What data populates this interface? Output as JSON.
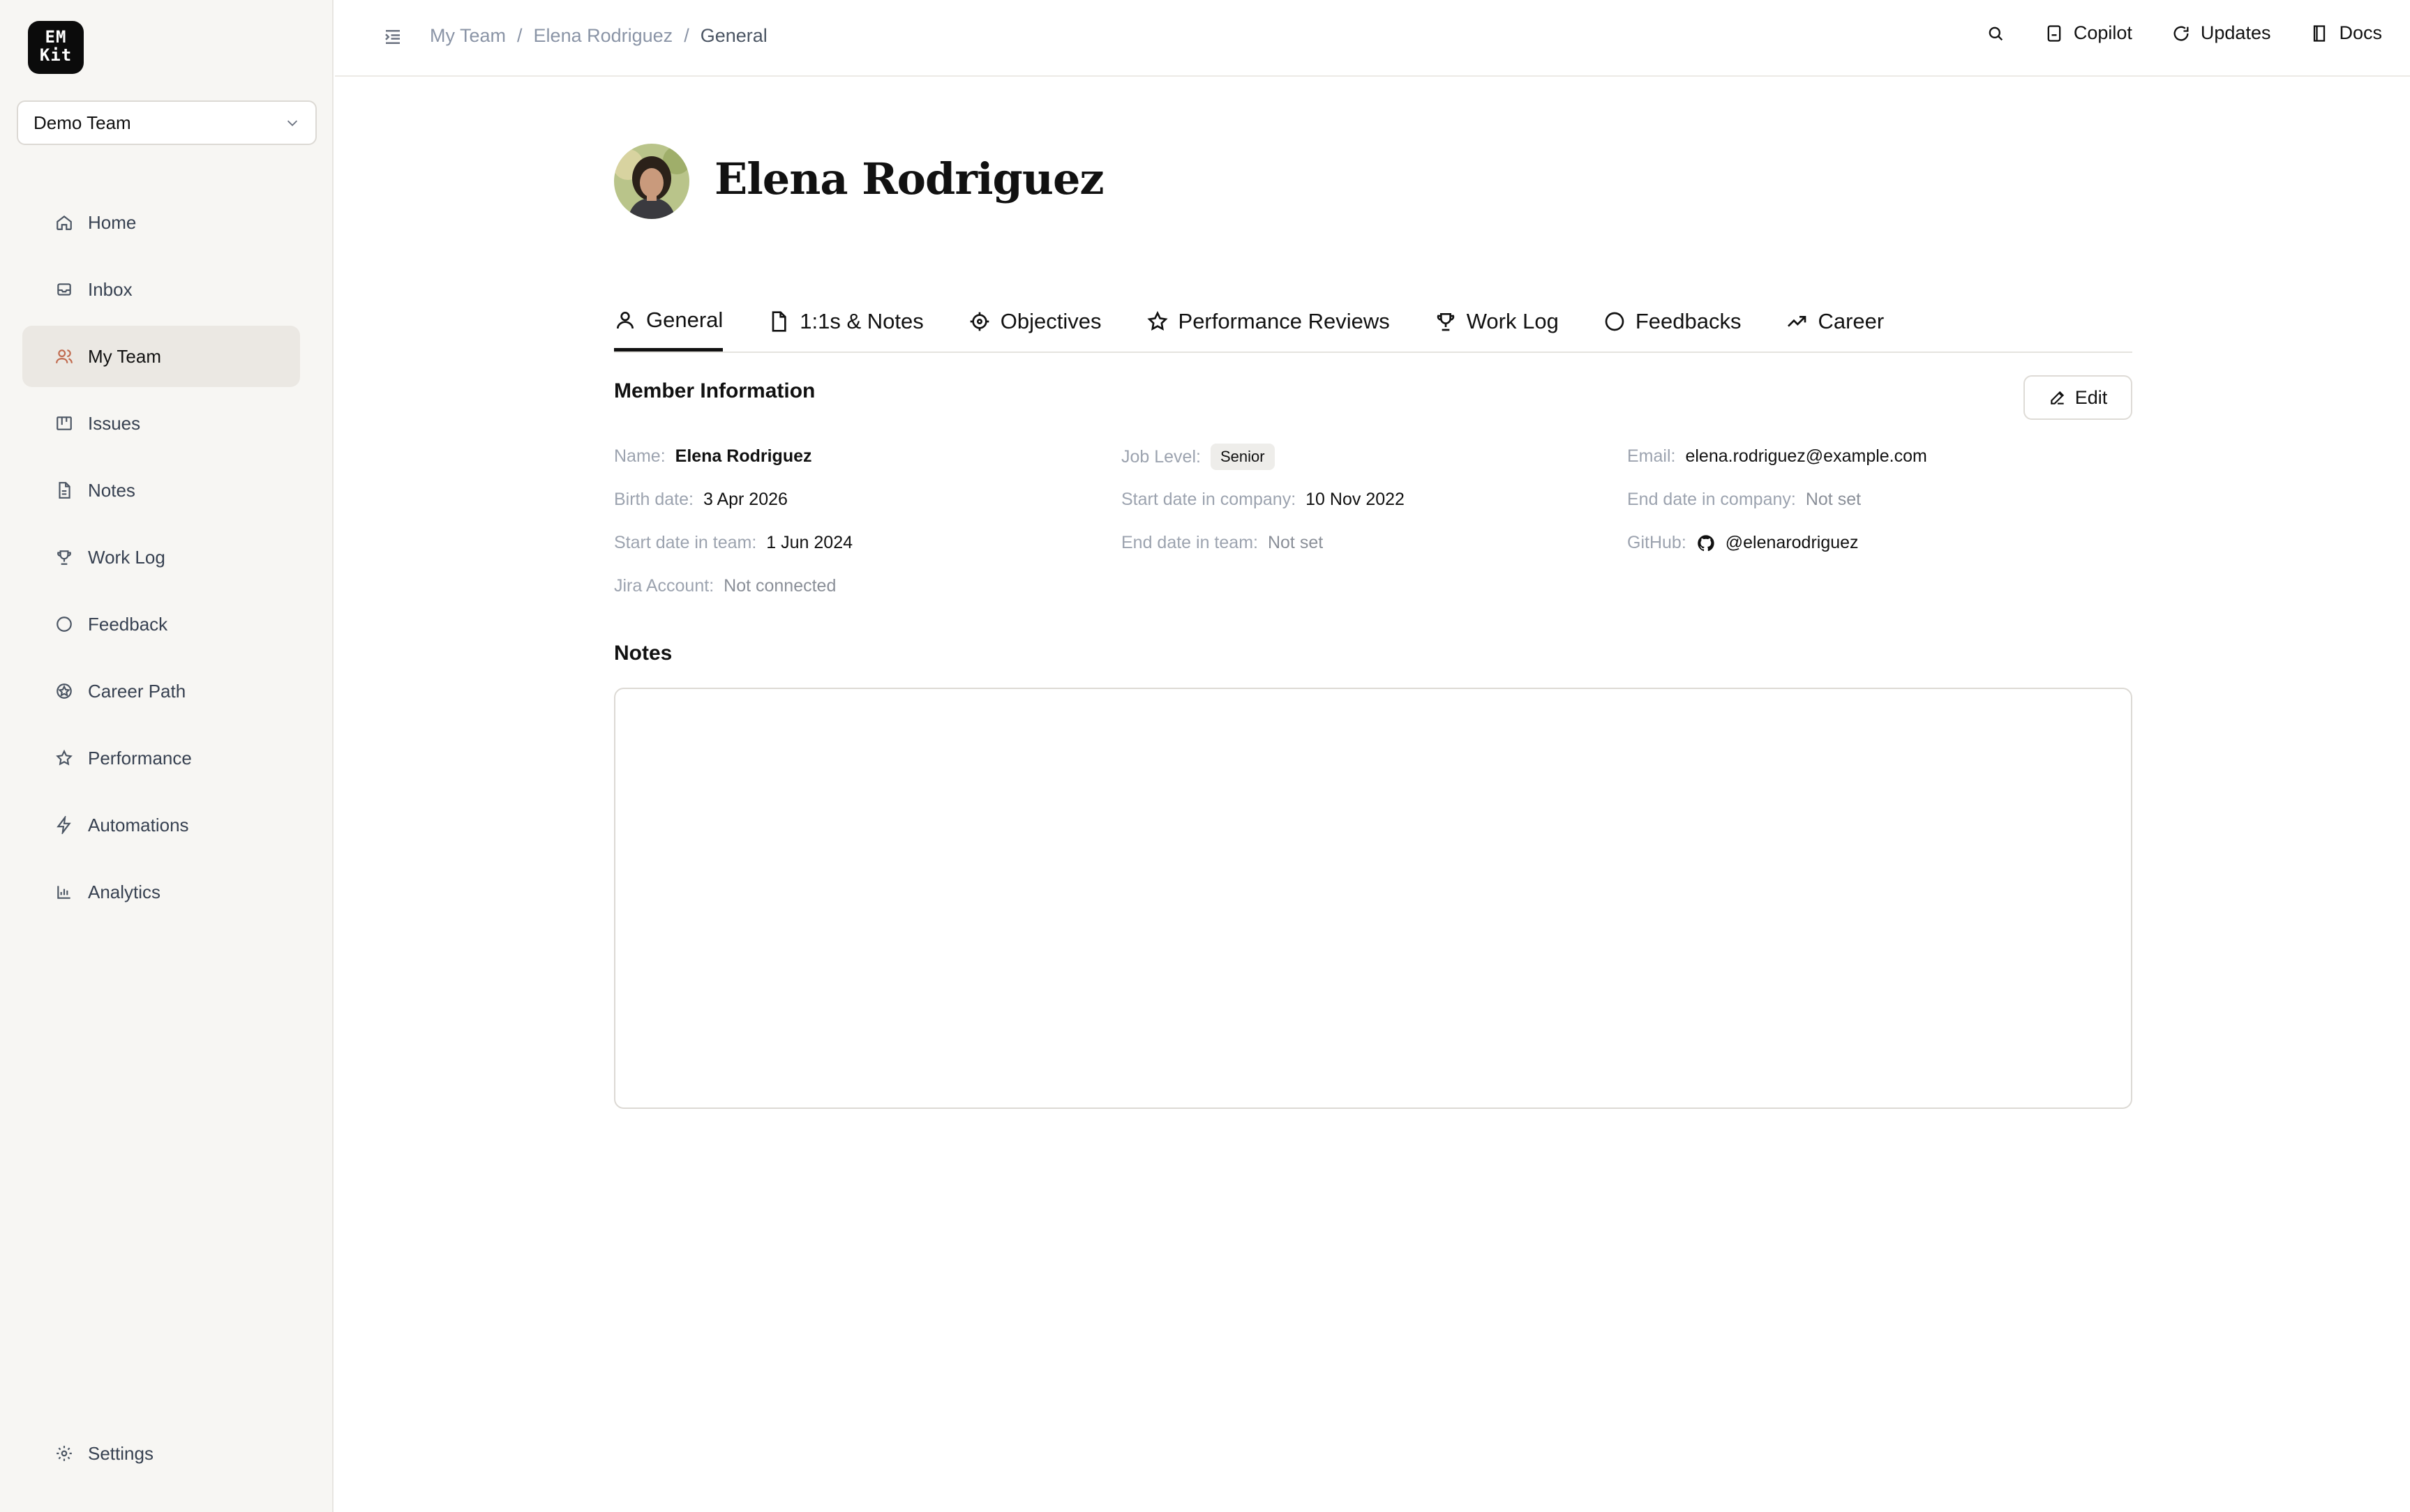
{
  "logo": {
    "line1": "EM",
    "line2": "Kit"
  },
  "team_selector": {
    "value": "Demo Team"
  },
  "sidebar": {
    "items": [
      {
        "label": "Home",
        "icon": "home-icon"
      },
      {
        "label": "Inbox",
        "icon": "inbox-icon"
      },
      {
        "label": "My Team",
        "icon": "users-icon",
        "active": true
      },
      {
        "label": "Issues",
        "icon": "kanban-icon"
      },
      {
        "label": "Notes",
        "icon": "file-icon"
      },
      {
        "label": "Work Log",
        "icon": "trophy-icon"
      },
      {
        "label": "Feedback",
        "icon": "message-icon"
      },
      {
        "label": "Career Path",
        "icon": "career-icon"
      },
      {
        "label": "Performance",
        "icon": "star-icon"
      },
      {
        "label": "Automations",
        "icon": "bolt-icon"
      },
      {
        "label": "Analytics",
        "icon": "bar-chart-icon"
      }
    ],
    "settings": "Settings"
  },
  "breadcrumb": [
    "My Team",
    "Elena Rodriguez",
    "General"
  ],
  "breadcrumb_sep": "/",
  "toplinks": {
    "copilot": "Copilot",
    "updates": "Updates",
    "docs": "Docs"
  },
  "profile": {
    "name": "Elena Rodriguez"
  },
  "tabs": [
    {
      "label": "General",
      "active": true
    },
    {
      "label": "1:1s & Notes"
    },
    {
      "label": "Objectives"
    },
    {
      "label": "Performance Reviews"
    },
    {
      "label": "Work Log"
    },
    {
      "label": "Feedbacks"
    },
    {
      "label": "Career"
    }
  ],
  "member_info": {
    "title": "Member Information",
    "edit": "Edit",
    "name_label": "Name",
    "name": "Elena Rodriguez",
    "birth_label": "Birth date",
    "birth": "3 Apr 2026",
    "team_start_label": "Start date in team",
    "team_start": "1 Jun 2024",
    "jira_label": "Jira Account",
    "jira": "Not connected",
    "level_label": "Job Level",
    "level": "Senior",
    "company_start_label": "Start date in company",
    "company_start": "10 Nov 2022",
    "team_end_label": "End date in team",
    "team_end": "Not set",
    "email_label": "Email",
    "email": "elena.rodriguez@example.com",
    "company_end_label": "End date in company",
    "company_end": "Not set",
    "github_label": "GitHub",
    "github": "@elenarodriguez"
  },
  "notes": {
    "title": "Notes"
  },
  "colors": {
    "accent": "#c06a4e",
    "sidebar_bg": "#f7f6f3"
  }
}
